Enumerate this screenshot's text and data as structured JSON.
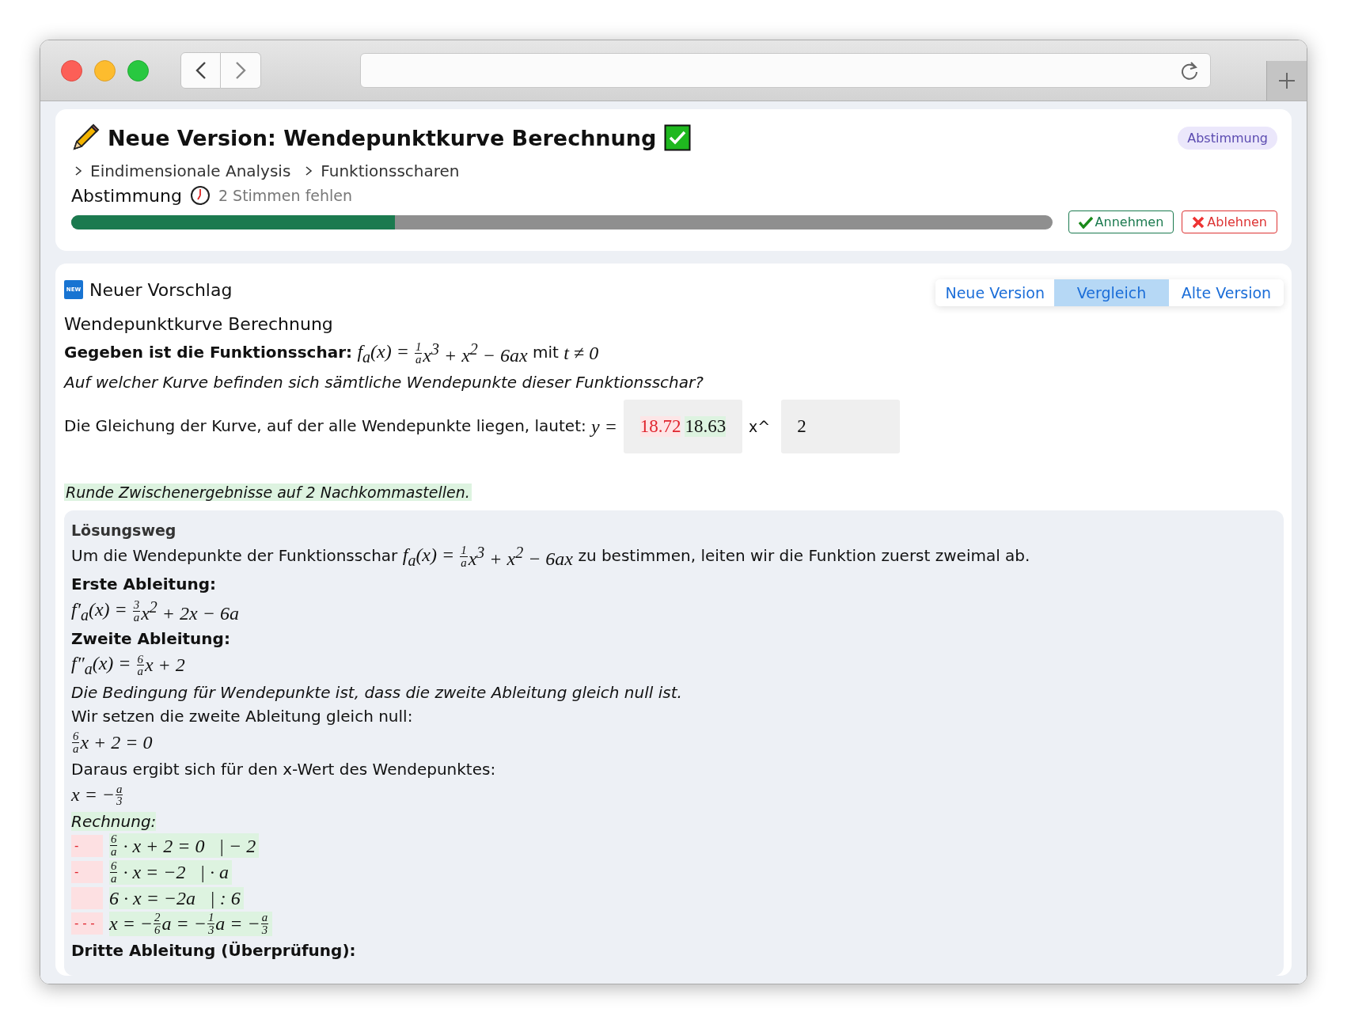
{
  "header": {
    "title": "Neue Version: Wendepunktkurve Berechnung",
    "badge": "Abstimmung",
    "breadcrumbs": [
      "Eindimensionale Analysis",
      "Funktionsscharen"
    ],
    "vote_label": "Abstimmung",
    "vote_status": "2 Stimmen fehlen",
    "progress": {
      "level": 0.33
    },
    "buttons": [
      {
        "label": "Annehmen",
        "kind": "accept"
      },
      {
        "label": "Ablehnen",
        "kind": "reject"
      }
    ]
  },
  "proposal": {
    "new_label": "NEW",
    "heading": "Neuer Vorschlag",
    "tabs": [
      {
        "label": "Neue Version",
        "selected": false
      },
      {
        "label": "Vergleich",
        "selected": true
      },
      {
        "label": "Alte Version",
        "selected": false
      }
    ],
    "task_title": "Wendepunktkurve Berechnung",
    "given": [
      {
        "kind": "text",
        "text": "**Gegeben ist die Funktionsschar:** "
      },
      {
        "kind": "math",
        "math": [
          "f$_{a}$(x) = ",
          {
            "num": "1",
            "den": "a"
          },
          "x$^{3}$ + x$^{2}$ − 6ax"
        ]
      },
      {
        "kind": "text",
        "text": " mit "
      },
      {
        "kind": "math",
        "math": [
          "t ≠ 0"
        ]
      }
    ],
    "question": "Auf welcher Kurve befinden sich sämtliche Wendepunkte dieser Funktionsschar?",
    "answer": {
      "prefix": [
        {
          "kind": "text",
          "text": "Die Gleichung der Kurve, auf der alle Wendepunkte liegen, lautet: "
        },
        {
          "kind": "math",
          "math": [
            "y ="
          ]
        }
      ],
      "input_1": [
        {
          "text": "18.72",
          "kind": "del"
        },
        {
          "text": "18.63",
          "kind": "ins"
        }
      ],
      "between": "x^",
      "input_2": "2"
    },
    "hint": "Runde Zwischenergebnisse auf 2 Nachkommastellen.",
    "solution": {
      "title": "Lösungsweg",
      "blocks": [
        {
          "kind": "para",
          "segments": [
            {
              "kind": "text",
              "text": "Um die Wendepunkte der Funktionsschar "
            },
            {
              "kind": "math",
              "math": [
                "f$_{a}$(x) = ",
                {
                  "num": "1",
                  "den": "a"
                },
                "x$^{3}$ + x$^{2}$ − 6ax"
              ]
            },
            {
              "kind": "text",
              "text": " zu bestimmen, leiten wir die Funktion zuerst zweimal ab."
            }
          ]
        },
        {
          "kind": "bold",
          "text": "Erste Ableitung:"
        },
        {
          "kind": "math",
          "math": [
            "f′$_{a}$(x) = ",
            {
              "num": "3",
              "den": "a"
            },
            "x$^{2}$ + 2x − 6a"
          ]
        },
        {
          "kind": "bold",
          "text": "Zweite Ableitung:"
        },
        {
          "kind": "math",
          "math": [
            "f″$_{a}$(x) = ",
            {
              "num": "6",
              "den": "a"
            },
            "x + 2"
          ]
        },
        {
          "kind": "italic",
          "text": "Die Bedingung für Wendepunkte ist, dass die zweite Ableitung gleich null ist."
        },
        {
          "kind": "plain",
          "text": "Wir setzen die zweite Ableitung gleich null:"
        },
        {
          "kind": "math",
          "math": [
            {
              "num": "6",
              "den": "a"
            },
            "x + 2 = 0"
          ]
        },
        {
          "kind": "plain",
          "text": "Daraus ergibt sich für den x-Wert des Wendepunktes:"
        },
        {
          "kind": "math",
          "math": [
            "x = −",
            {
              "num": "a",
              "den": "3"
            }
          ]
        },
        {
          "kind": "calc",
          "label": "Rechnung:",
          "rows": [
            {
              "marker": "-",
              "math": [
                {
                  "num": "6",
                  "den": "a"
                },
                " · x + 2 = 0   | − 2"
              ]
            },
            {
              "marker": "-",
              "math": [
                {
                  "num": "6",
                  "den": "a"
                },
                " · x = −2   | · a"
              ]
            },
            {
              "marker": "",
              "math": [
                "6 · x = −2a   | : 6"
              ]
            },
            {
              "marker": "- - -",
              "math": [
                "x = −",
                {
                  "num": "2",
                  "den": "6"
                },
                "a = −",
                {
                  "num": "1",
                  "den": "3"
                },
                "a = −",
                {
                  "num": "a",
                  "den": "3"
                }
              ]
            }
          ]
        },
        {
          "kind": "bold",
          "text": "Dritte Ableitung (Überprüfung):"
        }
      ]
    }
  }
}
